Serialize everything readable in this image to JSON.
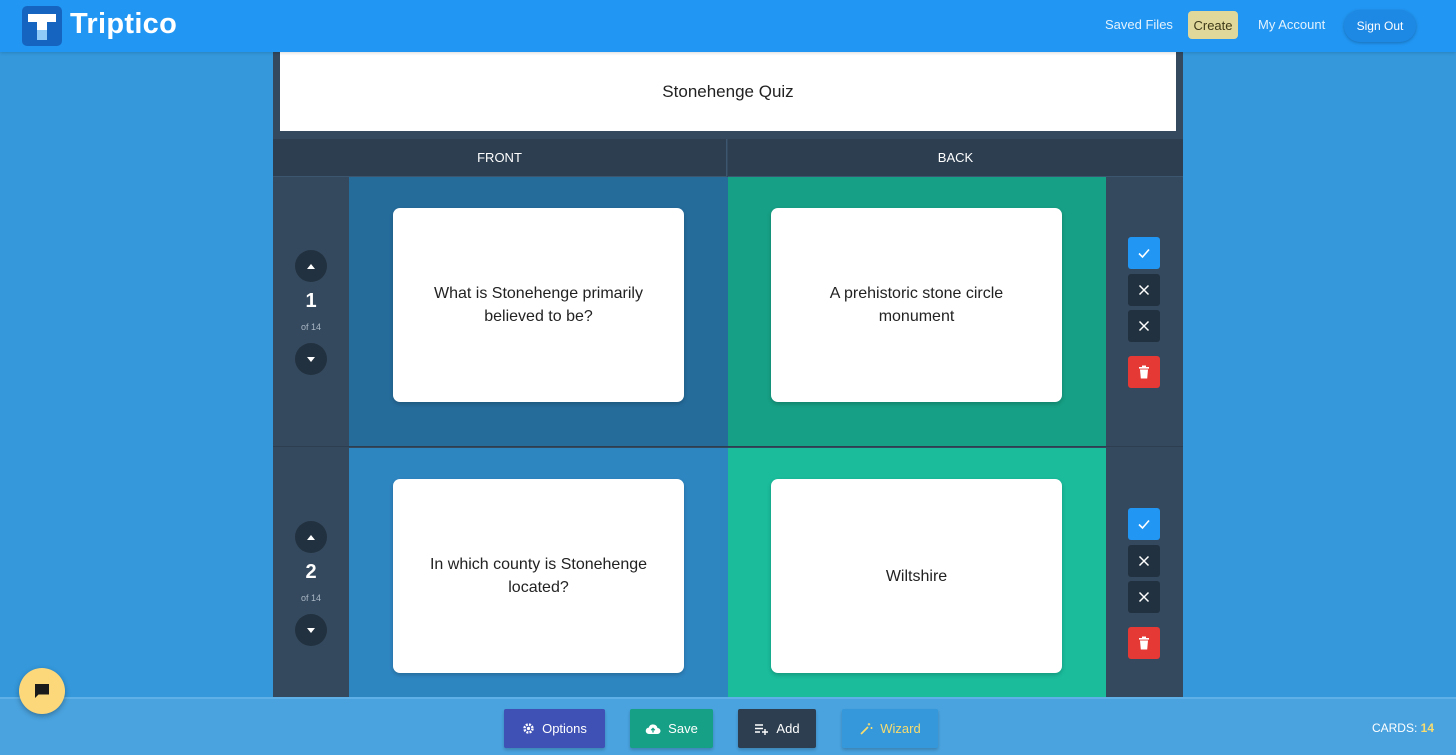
{
  "app": {
    "brand": "Triptico"
  },
  "nav": {
    "saved_files": "Saved Files",
    "create": "Create",
    "my_account": "My Account",
    "sign_out": "Sign Out"
  },
  "quiz": {
    "title": "Stonehenge Quiz"
  },
  "columns": {
    "front": "FRONT",
    "back": "BACK"
  },
  "cards": [
    {
      "number": "1",
      "of_label": "of 14",
      "front": "What is Stonehenge primarily believed to be?",
      "back": "A prehistoric stone circle monument"
    },
    {
      "number": "2",
      "of_label": "of 14",
      "front": "In which county is Stonehenge located?",
      "back": "Wiltshire"
    }
  ],
  "toolbar": {
    "options": "Options",
    "save": "Save",
    "add": "Add",
    "wizard": "Wizard",
    "cards_label": "CARDS:",
    "cards_count": "14"
  },
  "icons": {
    "move_up": "chevron-up-icon",
    "move_down": "chevron-down-icon",
    "confirm": "check-icon",
    "clear": "close-icon",
    "delete": "trash-icon",
    "options": "gear-icon",
    "save": "cloud-upload-icon",
    "add": "playlist-add-icon",
    "wizard": "magic-wand-icon",
    "chat": "chat-icon"
  },
  "colors": {
    "topbar": "#2196f3",
    "background": "#3498db",
    "panel": "#34495e",
    "create_button": "#e0d89a",
    "row1_front": "#256c9b",
    "row1_back": "#16a085",
    "row2_front": "#2e86c1",
    "row2_back": "#1abc9c",
    "confirm": "#2196f3",
    "delete": "#e53935",
    "options_button": "#3f51b5",
    "save_button": "#16a085",
    "add_button": "#2c3e50",
    "wizard_button": "#3498db",
    "accent_yellow": "#f7dc6f",
    "chat_button": "#fdd87a"
  }
}
